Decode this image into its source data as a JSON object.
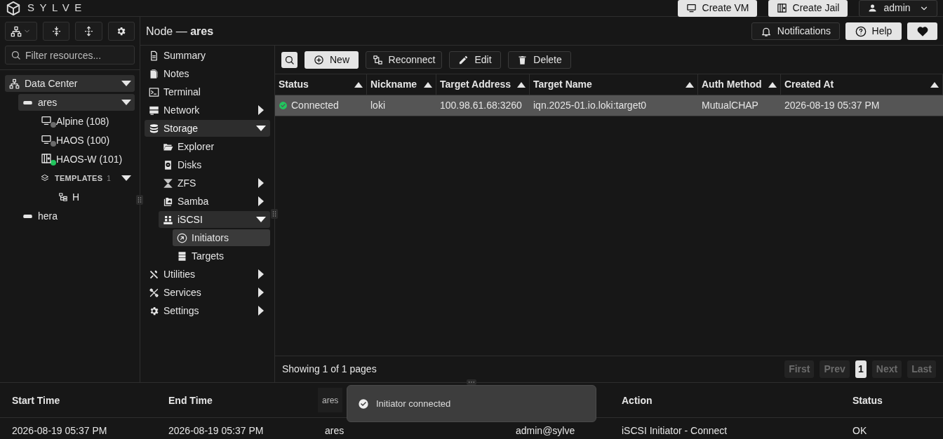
{
  "brand": "SYLVE",
  "header_buttons": [
    {
      "label": "Create VM",
      "kind": "light"
    },
    {
      "label": "Create Jail",
      "kind": "light"
    },
    {
      "label": "admin",
      "kind": "user"
    }
  ],
  "sidebar": {
    "search": {
      "placeholder": "Filter resources..."
    },
    "tree": [
      {
        "label": "Data Center",
        "kind": "datacenter",
        "highlighted": true,
        "expanded": true,
        "children": [
          {
            "label": "ares",
            "kind": "node",
            "highlighted": true,
            "expanded": true,
            "children": [
              {
                "label": "Alpine (108)",
                "kind": "vm",
                "running": false
              },
              {
                "label": "HAOS (100)",
                "kind": "vm",
                "running": false
              },
              {
                "label": "HAOS-W (101)",
                "kind": "jail",
                "running": true
              },
              {
                "label": "TEMPLATES",
                "kind": "group",
                "count": "1",
                "expanded": true,
                "children": [
                  {
                    "label": "H",
                    "kind": "template"
                  }
                ]
              }
            ]
          },
          {
            "label": "hera",
            "kind": "node",
            "highlighted": false
          }
        ]
      }
    ]
  },
  "page_title": {
    "prefix": "Node —",
    "name": "ares"
  },
  "top_actions": [
    {
      "label": "Notifications",
      "kind": "dark"
    },
    {
      "label": "Help",
      "kind": "light"
    },
    {
      "kind": "heart"
    }
  ],
  "nav": [
    {
      "label": "Summary",
      "highlighted": false,
      "selected": false
    },
    {
      "label": "Notes",
      "highlighted": false,
      "selected": false
    },
    {
      "label": "Terminal",
      "highlighted": false,
      "selected": false
    },
    {
      "label": "Network",
      "highlighted": false,
      "selected": false,
      "expanded": false
    },
    {
      "label": "Storage",
      "highlighted": true,
      "selected": false,
      "expanded": true,
      "children": [
        {
          "label": "Explorer",
          "highlighted": false,
          "selected": false
        },
        {
          "label": "Disks",
          "highlighted": false,
          "selected": false
        },
        {
          "label": "ZFS",
          "highlighted": false,
          "selected": false,
          "expanded": false
        },
        {
          "label": "Samba",
          "highlighted": false,
          "selected": false,
          "expanded": false
        },
        {
          "label": "iSCSI",
          "highlighted": true,
          "selected": false,
          "expanded": true,
          "children": [
            {
              "label": "Initiators",
              "highlighted": false,
              "selected": true
            },
            {
              "label": "Targets",
              "highlighted": false,
              "selected": false
            }
          ]
        }
      ]
    },
    {
      "label": "Utilities",
      "highlighted": false,
      "selected": false,
      "expanded": false
    },
    {
      "label": "Services",
      "highlighted": false,
      "selected": false,
      "expanded": false
    },
    {
      "label": "Settings",
      "highlighted": false,
      "selected": false,
      "expanded": false
    }
  ],
  "toolbar": [
    {
      "label": "New",
      "kind": "light"
    },
    {
      "label": "Reconnect",
      "kind": "dark"
    },
    {
      "label": "Edit",
      "kind": "dark"
    },
    {
      "label": "Delete",
      "kind": "dark"
    }
  ],
  "table": {
    "columns": [
      "Status",
      "Nickname",
      "Target Address",
      "Target Name",
      "Auth Method",
      "Created At"
    ],
    "rows": [
      {
        "selected": true,
        "connected": true,
        "cells": [
          "Connected",
          "loki",
          "100.98.61.68:3260",
          "iqn.2025-01.io.loki:target0",
          "MutualCHAP",
          "2026-08-19 05:37 PM"
        ]
      }
    ]
  },
  "pagination": {
    "summary": "Showing 1 of 1 pages",
    "buttons": [
      {
        "label": "First",
        "disabled": true,
        "selected": false
      },
      {
        "label": "Prev",
        "disabled": true,
        "selected": false
      },
      {
        "label": "1",
        "disabled": false,
        "selected": true
      },
      {
        "label": "Next",
        "disabled": true,
        "selected": false
      },
      {
        "label": "Last",
        "disabled": true,
        "selected": false
      }
    ]
  },
  "audit_log": {
    "columns": [
      "Start Time",
      "End Time",
      "ares",
      "",
      "Action",
      "Status"
    ],
    "rows": [
      [
        "2026-08-19 05:37 PM",
        "2026-08-19 05:37 PM",
        "ares",
        "admin@sylve",
        "iSCSI Initiator - Connect",
        "OK"
      ]
    ]
  },
  "toast": {
    "message": "Initiator connected",
    "kind": "success"
  }
}
